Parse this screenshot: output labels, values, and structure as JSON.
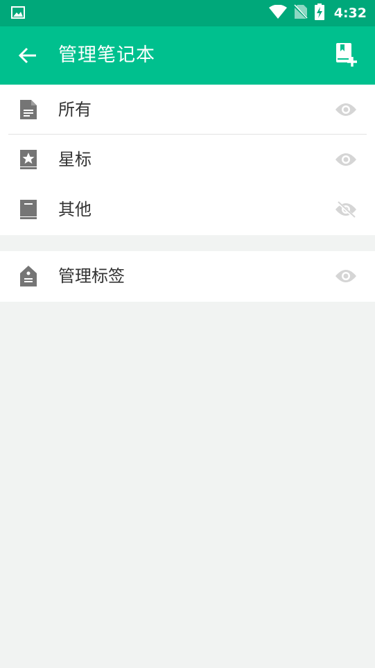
{
  "status_bar": {
    "time": "4:32"
  },
  "app_bar": {
    "title": "管理笔记本"
  },
  "notebooks": [
    {
      "label": "所有",
      "icon": "document-icon",
      "visible": true
    },
    {
      "label": "星标",
      "icon": "star-book-icon",
      "visible": true
    },
    {
      "label": "其他",
      "icon": "book-icon",
      "visible": false
    }
  ],
  "tags": [
    {
      "label": "管理标签",
      "icon": "tag-icon",
      "visible": true
    }
  ],
  "colors": {
    "status_bar": "#00a87a",
    "app_bar": "#00c08e",
    "background": "#f1f3f2",
    "icon_gray": "#757575",
    "eye_gray": "#d5d5d5"
  }
}
